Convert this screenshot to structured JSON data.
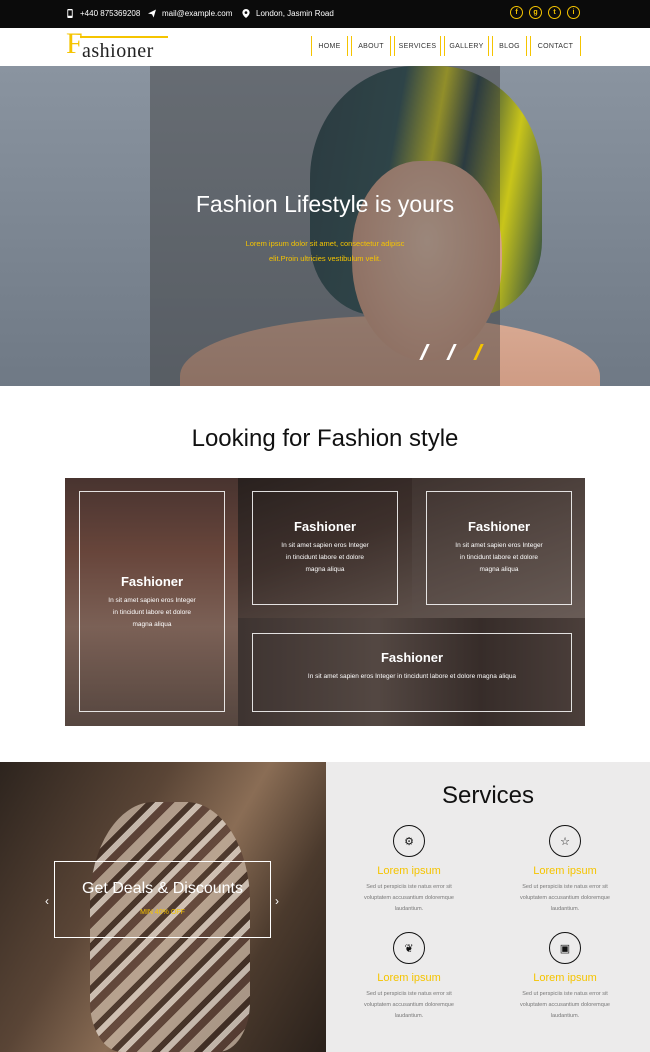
{
  "topbar": {
    "phone": "+440 875369208",
    "email": "mail@example.com",
    "address": "London, Jasmin Road",
    "social": [
      "f",
      "g",
      "t",
      "i"
    ]
  },
  "header": {
    "logo_initial": "F",
    "logo_rest": "ashioner",
    "nav": [
      "HOME",
      "ABOUT",
      "SERVICES",
      "GALLERY",
      "BLOG",
      "CONTACT"
    ]
  },
  "hero": {
    "title": "Fashion Lifestyle is yours",
    "subtitle_line1": "Lorem ipsum dolor sit amet, consectetur adipisc",
    "subtitle_line2": "elit.Proin ultricies vestibulum velit.",
    "active_slide": 3
  },
  "style_section": {
    "title": "Looking for Fashion style",
    "cards": [
      {
        "title": "Fashioner",
        "line1": "In sit amet sapien eros Integer",
        "line2": "in tincidunt labore et dolore",
        "line3": "magna aliqua"
      },
      {
        "title": "Fashioner",
        "line1": "In sit amet sapien eros Integer",
        "line2": "in tincidunt labore et dolore",
        "line3": "magna aliqua"
      },
      {
        "title": "Fashioner",
        "line1": "In sit amet sapien eros Integer",
        "line2": "in tincidunt labore et dolore",
        "line3": "magna aliqua"
      },
      {
        "title": "Fashioner",
        "line1": "In sit amet sapien eros Integer in tincidunt labore et dolore magna aliqua",
        "line2": "",
        "line3": ""
      }
    ]
  },
  "deal": {
    "title": "Get Deals & Discounts",
    "subtitle": "MIN 40% OFF",
    "prev": "‹",
    "next": "›"
  },
  "services": {
    "heading": "Services",
    "items": [
      {
        "icon": "gear-icon",
        "glyph": "⚙",
        "title": "Lorem ipsum",
        "line1": "Sed ut perspiciis iste natus error sit",
        "line2": "voluptatem accusantium doloremque",
        "line3": "laudantium."
      },
      {
        "icon": "star-icon",
        "glyph": "☆",
        "title": "Lorem ipsum",
        "line1": "Sed ut perspiciis iste natus error sit",
        "line2": "voluptatem accusantium doloremque",
        "line3": "laudantium."
      },
      {
        "icon": "leaf-icon",
        "glyph": "❦",
        "title": "Lorem ipsum",
        "line1": "Sed ut perspiciis iste natus error sit",
        "line2": "voluptatem accusantium doloremque",
        "line3": "laudantium."
      },
      {
        "icon": "gift-icon",
        "glyph": "▣",
        "title": "Lorem ipsum",
        "line1": "Sed ut perspiciis iste natus error sit",
        "line2": "voluptatem accusantium doloremque",
        "line3": "laudantium."
      }
    ]
  },
  "colors": {
    "accent": "#f5c400",
    "topbar": "#0b0b0b",
    "services_bg": "#ecebeb"
  }
}
